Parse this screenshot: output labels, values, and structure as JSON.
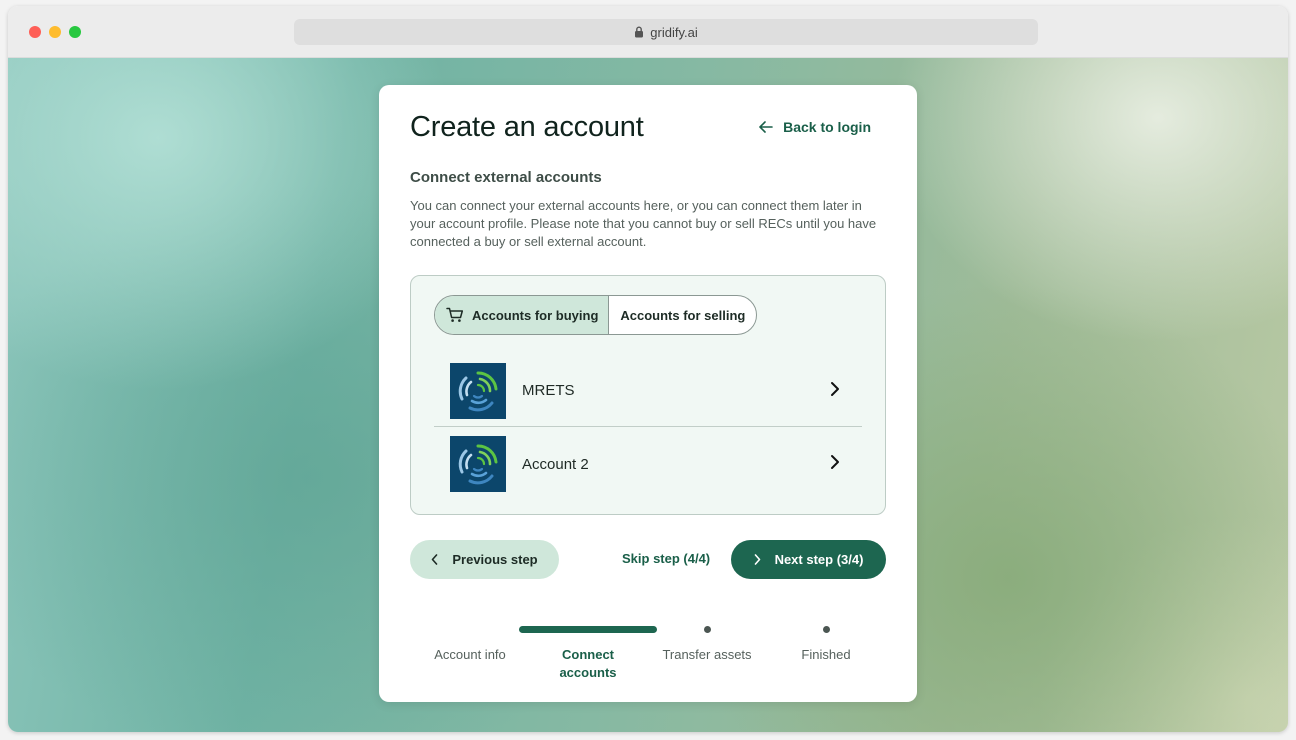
{
  "browser": {
    "url": "gridify.ai"
  },
  "card": {
    "title": "Create an account",
    "back_label": "Back to login"
  },
  "section": {
    "title": "Connect external accounts",
    "description": "You can connect your external accounts here, or you can connect them later in your account profile. Please note that you cannot buy or sell RECs until you have connected a buy or sell external account."
  },
  "tabs": [
    {
      "label": "Accounts for buying",
      "icon": "cart-icon",
      "active": true
    },
    {
      "label": "Accounts for selling",
      "active": false
    }
  ],
  "accounts": [
    {
      "name": "MRETS",
      "logo": "mrets-logo"
    },
    {
      "name": "Account 2",
      "logo": "mrets-logo"
    }
  ],
  "actions": {
    "previous_label": "Previous step",
    "skip_label": "Skip step (4/4)",
    "next_label": "Next step (3/4)"
  },
  "steps": [
    {
      "label": "Account info",
      "state": "done"
    },
    {
      "label": "Connect accounts",
      "state": "active"
    },
    {
      "label": "Transfer assets",
      "state": "upcoming"
    },
    {
      "label": "Finished",
      "state": "upcoming"
    }
  ],
  "colors": {
    "brand_green": "#1d6650",
    "brand_light": "#cfe7da",
    "logo_blue": "#0c466b"
  }
}
